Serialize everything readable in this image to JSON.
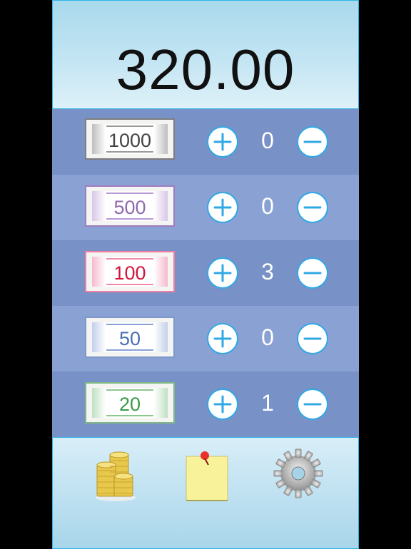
{
  "total": {
    "value": "320.00"
  },
  "denominations": [
    {
      "label": "1000",
      "count": "0",
      "color": "#555555",
      "accent": "#8c8c8c"
    },
    {
      "label": "500",
      "count": "0",
      "color": "#8e6ab0",
      "accent": "#b08ed0"
    },
    {
      "label": "100",
      "count": "3",
      "color": "#d2143c",
      "accent": "#f08aa8"
    },
    {
      "label": "50",
      "count": "0",
      "color": "#4a6fb5",
      "accent": "#8aa3d8"
    },
    {
      "label": "20",
      "count": "1",
      "color": "#3c9a4a",
      "accent": "#8cc690"
    }
  ],
  "toolbar": [
    {
      "icon": "coins-icon"
    },
    {
      "icon": "sticky-note-icon"
    },
    {
      "icon": "gear-icon"
    }
  ],
  "colors": {
    "accent": "#2fa8e6",
    "row_dark": "#7891c6",
    "row_light": "#8aa1d3"
  }
}
